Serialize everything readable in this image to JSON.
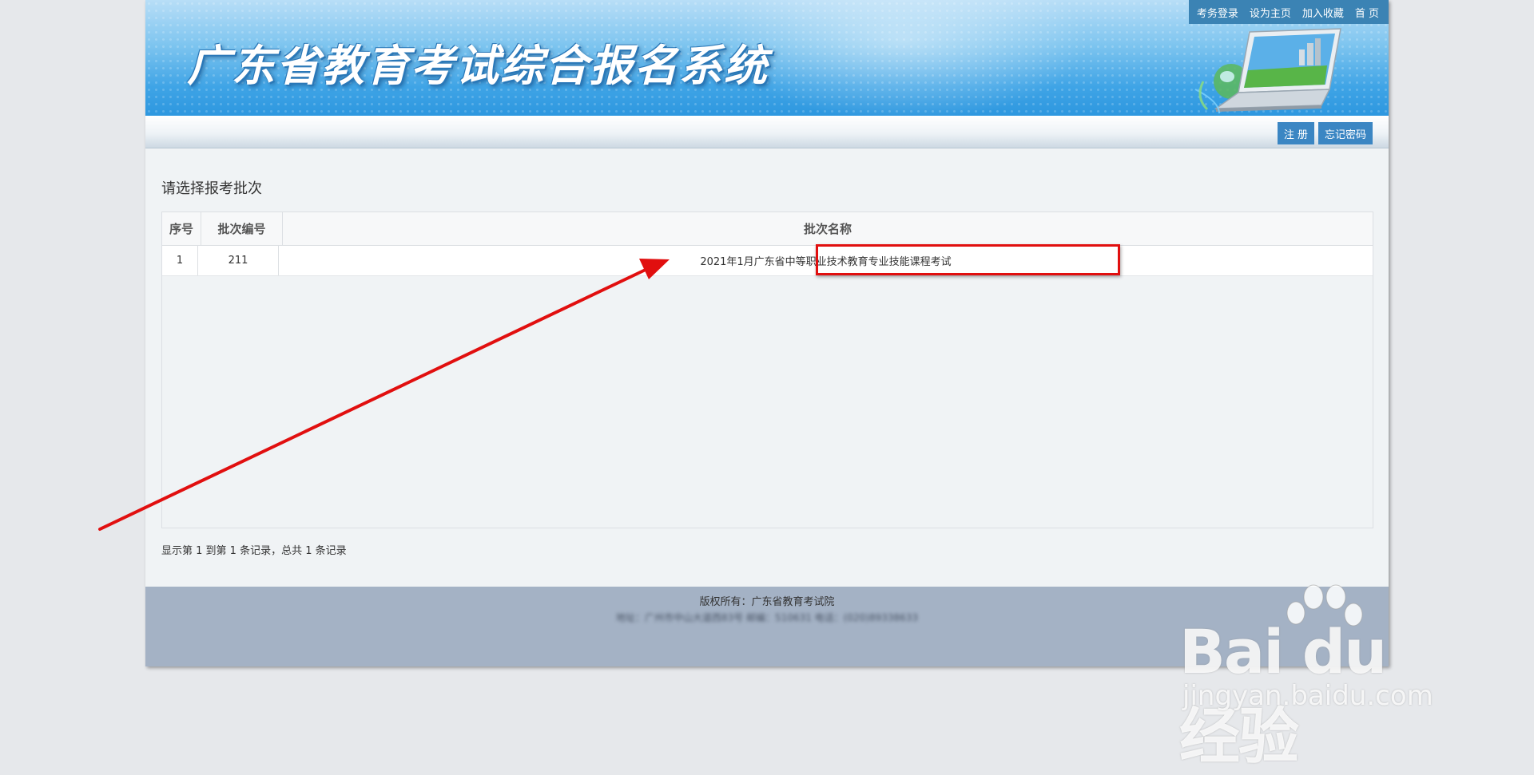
{
  "header": {
    "site_title": "广东省教育考试综合报名系统",
    "top_links": [
      "考务登录",
      "设为主页",
      "加入收藏",
      "首 页"
    ]
  },
  "subbar": {
    "register_label": "注 册",
    "forgot_label": "忘记密码"
  },
  "main": {
    "section_title": "请选择报考批次",
    "table": {
      "columns": [
        "序号",
        "批次编号",
        "批次名称"
      ],
      "rows": [
        {
          "index": "1",
          "code": "211",
          "name": "2021年1月广东省中等职业技术教育专业技能课程考试"
        }
      ]
    },
    "pager_text": "显示第 1 到第 1 条记录，总共 1 条记录"
  },
  "footer": {
    "copyright": "版权所有：广东省教育考试院",
    "address": "地址：广州市中山大道西83号 邮编：510631 电话：(020)89338633"
  },
  "annotation": {
    "color": "#e10f0f"
  },
  "watermark": {
    "logo_text": "Bai du 经验",
    "url_text": "jingyan.baidu.com"
  }
}
